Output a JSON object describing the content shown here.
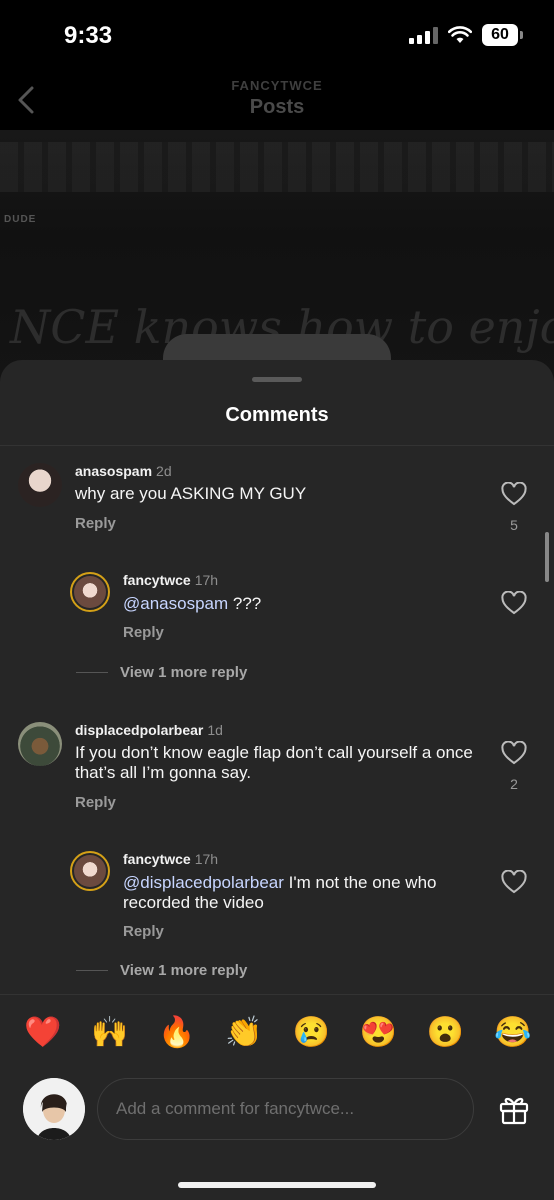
{
  "status_bar": {
    "time": "9:33",
    "battery": "60"
  },
  "header": {
    "subtitle": "FANCYTWCE",
    "title": "Posts"
  },
  "video": {
    "tag": "DUDE",
    "script_text": "NCE knows how to enjoy, a"
  },
  "sheet": {
    "title": "Comments"
  },
  "comments": [
    {
      "username": "anasospam",
      "time": "2d",
      "text": "why are you ASKING MY GUY",
      "reply_label": "Reply",
      "likes": "5",
      "replies": [
        {
          "username": "fancytwce",
          "time": "17h",
          "mention": "@anasospam",
          "text": " ???",
          "reply_label": "Reply"
        }
      ],
      "view_more": "View 1 more reply"
    },
    {
      "username": "displacedpolarbear",
      "time": "1d",
      "text": "If you don’t know eagle flap don’t call yourself a once that’s all I’m gonna say.",
      "reply_label": "Reply",
      "likes": "2",
      "replies": [
        {
          "username": "fancytwce",
          "time": "17h",
          "mention": "@displacedpolarbear",
          "text": " I'm not the one who recorded the video",
          "reply_label": "Reply"
        }
      ],
      "view_more": "View 1 more reply"
    }
  ],
  "emoji_reactions": [
    "❤️",
    "🙌",
    "🔥",
    "👏",
    "😢",
    "😍",
    "😮",
    "😂"
  ],
  "input": {
    "placeholder": "Add a comment for fancytwce..."
  },
  "colors": {
    "sheet_bg": "#262626",
    "mention": "#c7d5ff",
    "story_ring": "#d4a017"
  }
}
